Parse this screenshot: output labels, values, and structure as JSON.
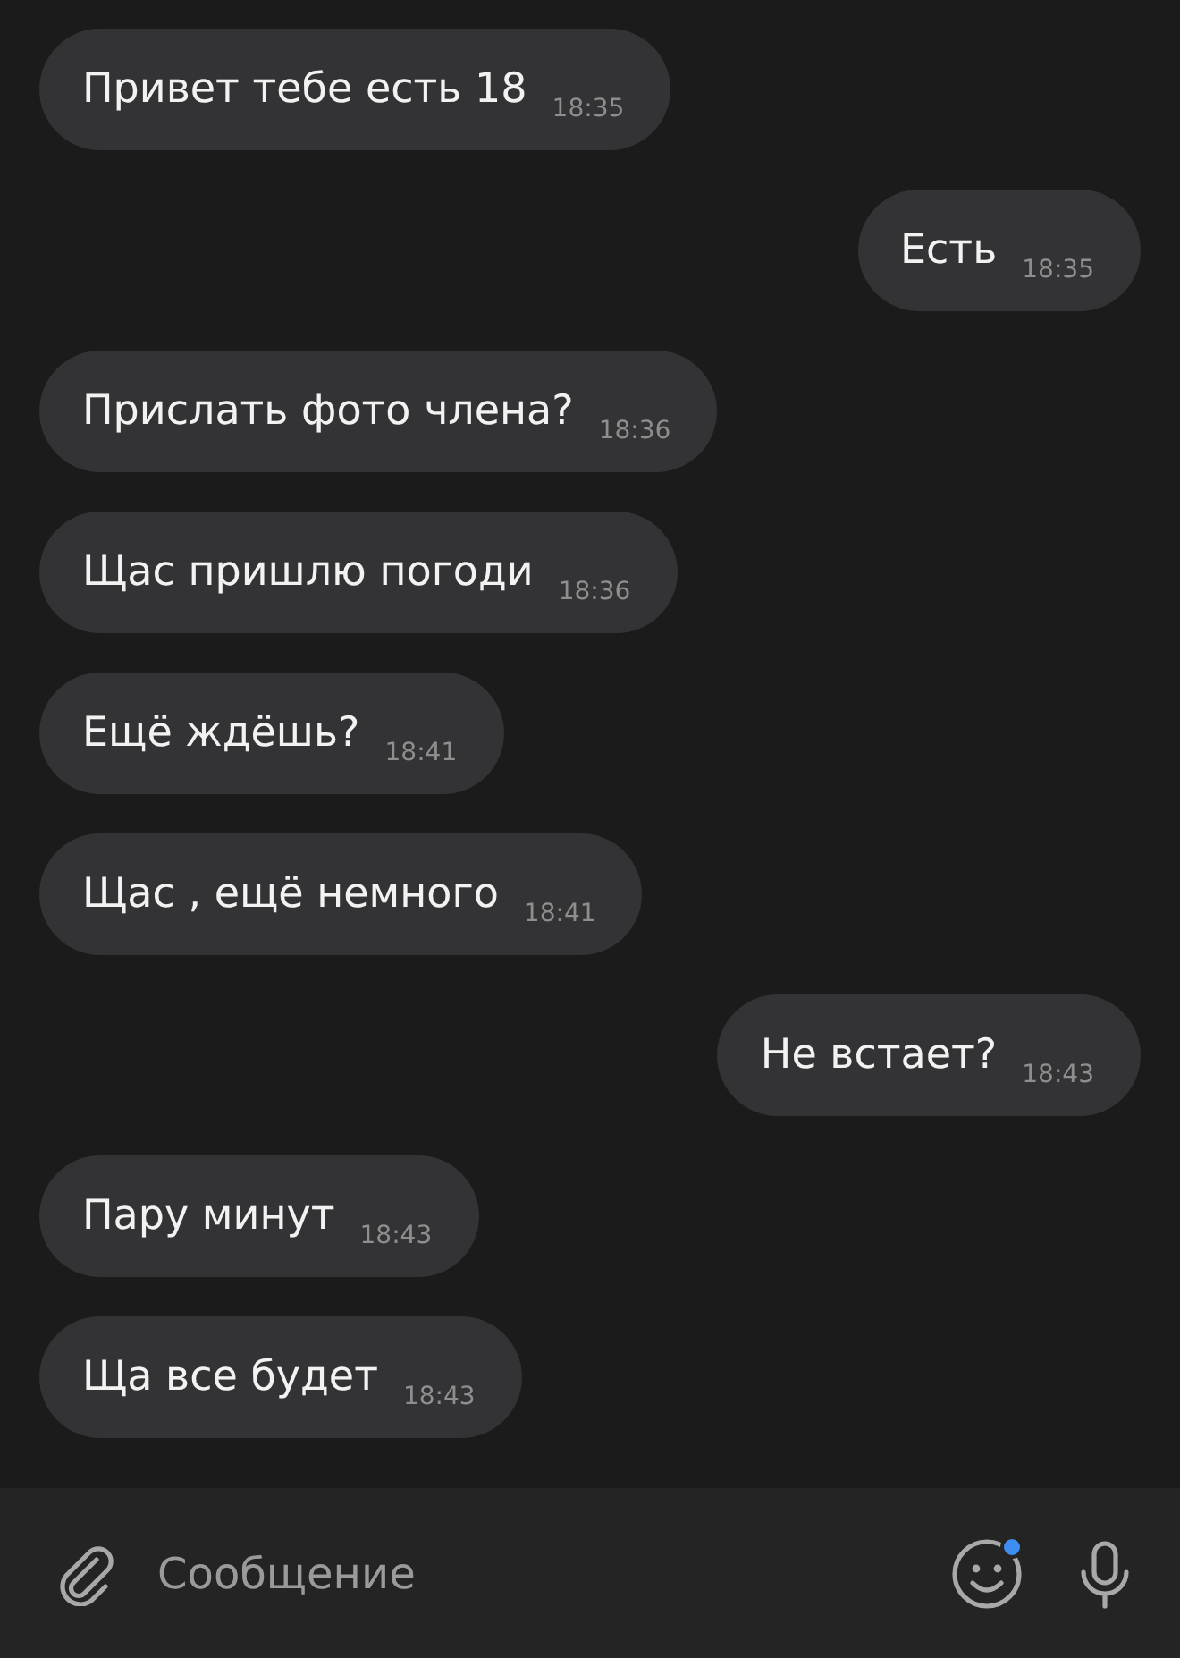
{
  "messages": [
    {
      "text": "Привет тебе есть 18",
      "time": "18:35",
      "outgoing": false
    },
    {
      "text": "Есть",
      "time": "18:35",
      "outgoing": true
    },
    {
      "text": "Прислать фото члена?",
      "time": "18:36",
      "outgoing": false
    },
    {
      "text": "Щас пришлю погоди",
      "time": "18:36",
      "outgoing": false
    },
    {
      "text": "Ещё ждёшь?",
      "time": "18:41",
      "outgoing": false
    },
    {
      "text": "Щас , ещё немного",
      "time": "18:41",
      "outgoing": false
    },
    {
      "text": "Не встает?",
      "time": "18:43",
      "outgoing": true
    },
    {
      "text": "Пару минут",
      "time": "18:43",
      "outgoing": false
    },
    {
      "text": "Ща все будет",
      "time": "18:43",
      "outgoing": false
    }
  ],
  "composer": {
    "placeholder": "Сообщение"
  }
}
